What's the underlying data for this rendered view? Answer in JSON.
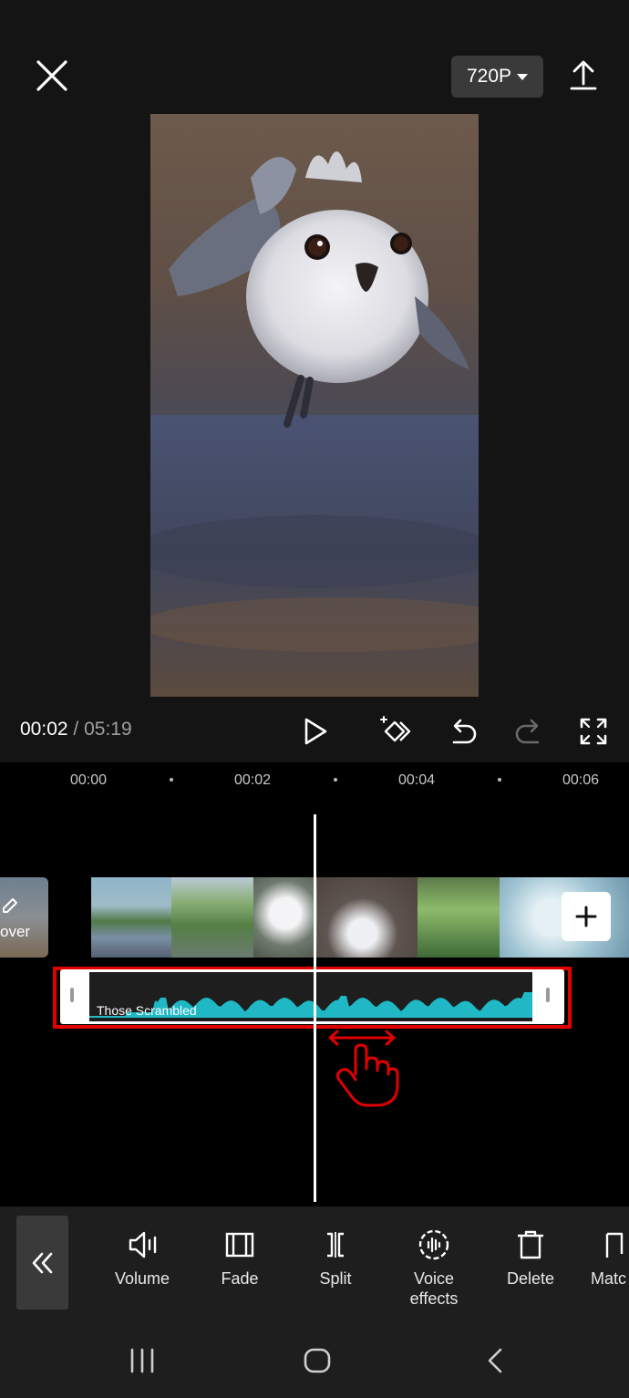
{
  "top_bar": {
    "resolution": "720P"
  },
  "playback": {
    "current_time": "00:02",
    "separator": "/",
    "total_time": "05:19"
  },
  "timeline": {
    "ruler": [
      "00:00",
      "00:02",
      "00:04",
      "00:06"
    ],
    "cover_label": "over",
    "audio_clip_name": "Those Scrambled"
  },
  "toolbar": {
    "items": [
      {
        "label": "Volume",
        "icon": "volume-icon"
      },
      {
        "label": "Fade",
        "icon": "fade-icon"
      },
      {
        "label": "Split",
        "icon": "split-icon"
      },
      {
        "label": "Voice effects",
        "icon": "voice-effects-icon"
      },
      {
        "label": "Delete",
        "icon": "delete-icon"
      },
      {
        "label": "Matc",
        "icon": "match-icon"
      }
    ]
  },
  "colors": {
    "background": "#141414",
    "timeline": "#000000",
    "highlight": "#e00000",
    "waveform": "#1fb8c4",
    "toolbar": "#1e1e1e"
  }
}
